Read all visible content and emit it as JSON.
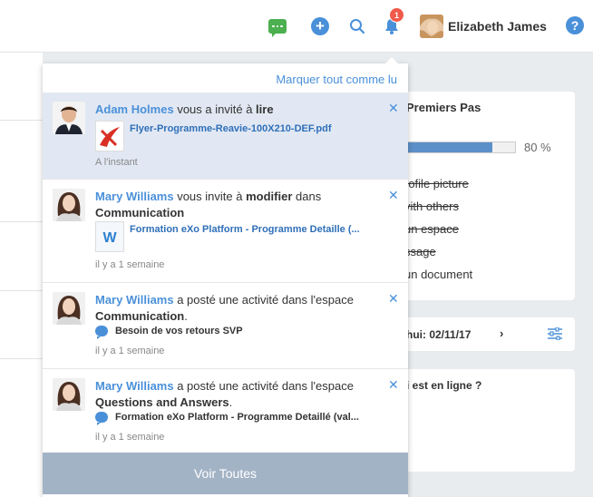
{
  "topbar": {
    "badge_count": "1",
    "username": "Elizabeth James",
    "help_label": "?",
    "icons": [
      "chat-icon",
      "plus-icon",
      "search-icon",
      "bell-icon",
      "help-icon"
    ]
  },
  "colors": {
    "accent": "#4a90d9",
    "badge": "#f05a4a",
    "chat": "#4caf50",
    "unread_bg": "#e1e8f3",
    "see_all_bg": "#a3b3c6"
  },
  "dropdown": {
    "mark_all": "Marquer tout comme lu",
    "see_all": "Voir Toutes",
    "items": [
      {
        "who": "Adam Holmes",
        "t1": " vous a invité à ",
        "b1": "lire",
        "t2": "",
        "b2": "",
        "t3": "",
        "attachment": "Flyer-Programme-Reavie-100X210-DEF.pdf",
        "time": "A l'instant"
      },
      {
        "who": "Mary Williams",
        "t1": " vous invite à ",
        "b1": "modifier",
        "t2": " dans ",
        "b2": "Communication",
        "t3": "",
        "attachment": "Formation eXo Platform - Programme Detaille (...",
        "time": "il y a 1 semaine"
      },
      {
        "who": "Mary Williams",
        "t1": " a posté une activité dans l'espace ",
        "b1": "Communication",
        "t2": ".",
        "b2": "",
        "t3": "",
        "attachment": "Besoin de vos retours SVP",
        "time": "il y a 1 semaine"
      },
      {
        "who": "Mary Williams",
        "t1": " a posté une activité dans l'espace ",
        "b1": "Questions and Answers",
        "t2": ".",
        "b2": "",
        "t3": "",
        "attachment": "Formation eXo Platform - Programme Detaillé (val...",
        "time": "il y a 1 semaine"
      }
    ]
  },
  "right": {
    "getting_started_title": "Premiers Pas",
    "progress_percent": 80,
    "progress_label": "80 %",
    "tasks": [
      {
        "label": "rofile picture",
        "done": true
      },
      {
        "label": "vith others",
        "done": true
      },
      {
        "label": "un espace",
        "done": true
      },
      {
        "label": "ssage",
        "done": true
      },
      {
        "label": "un document",
        "done": false
      }
    ],
    "calendar_date": "hui: 02/11/17",
    "calendar_next": "›",
    "who_online": "i est en ligne ?"
  }
}
